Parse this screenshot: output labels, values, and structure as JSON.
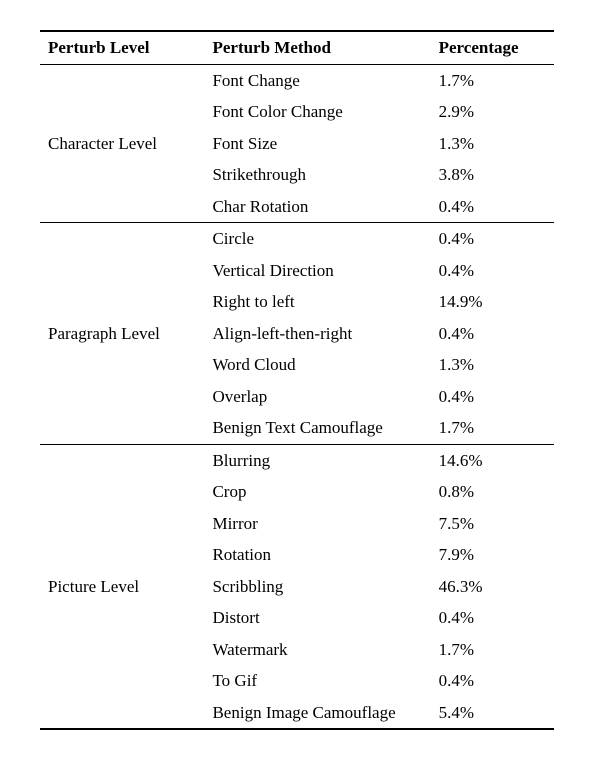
{
  "headers": {
    "level": "Perturb Level",
    "method": "Perturb Method",
    "percentage": "Percentage"
  },
  "groups": [
    {
      "label": "Character Level",
      "rows": [
        {
          "method": "Font Change",
          "percentage": "1.7%"
        },
        {
          "method": "Font Color Change",
          "percentage": "2.9%"
        },
        {
          "method": "Font Size",
          "percentage": "1.3%"
        },
        {
          "method": "Strikethrough",
          "percentage": "3.8%"
        },
        {
          "method": "Char Rotation",
          "percentage": "0.4%"
        }
      ]
    },
    {
      "label": "Paragraph Level",
      "rows": [
        {
          "method": "Circle",
          "percentage": "0.4%"
        },
        {
          "method": "Vertical Direction",
          "percentage": "0.4%"
        },
        {
          "method": "Right to left",
          "percentage": "14.9%"
        },
        {
          "method": "Align-left-then-right",
          "percentage": "0.4%"
        },
        {
          "method": "Word Cloud",
          "percentage": "1.3%"
        },
        {
          "method": "Overlap",
          "percentage": "0.4%"
        },
        {
          "method": "Benign Text Camouflage",
          "percentage": "1.7%"
        }
      ]
    },
    {
      "label": "Picture Level",
      "rows": [
        {
          "method": "Blurring",
          "percentage": "14.6%"
        },
        {
          "method": "Crop",
          "percentage": "0.8%"
        },
        {
          "method": "Mirror",
          "percentage": "7.5%"
        },
        {
          "method": "Rotation",
          "percentage": "7.9%"
        },
        {
          "method": "Scribbling",
          "percentage": "46.3%"
        },
        {
          "method": "Distort",
          "percentage": "0.4%"
        },
        {
          "method": "Watermark",
          "percentage": "1.7%"
        },
        {
          "method": "To Gif",
          "percentage": "0.4%"
        },
        {
          "method": "Benign Image Camouflage",
          "percentage": "5.4%"
        }
      ]
    }
  ]
}
